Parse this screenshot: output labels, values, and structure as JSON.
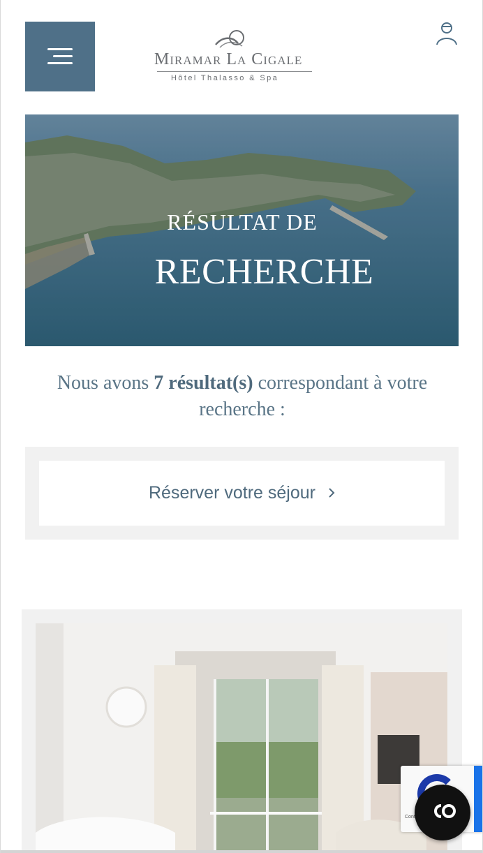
{
  "header": {
    "menu_icon": "hamburger-icon",
    "logo": {
      "name": "Miramar La Cigale",
      "subtitle": "Hôtel Thalasso & Spa"
    },
    "user_icon": "user-icon"
  },
  "hero": {
    "title_line1": "RÉSULTAT DE",
    "title_line2": "RECHERCHE"
  },
  "results": {
    "prefix": "Nous avons ",
    "count_text": "7 résultat(s)",
    "suffix": " correspondant à votre recherche :"
  },
  "reserve": {
    "label": "Réserver votre séjour",
    "icon": "chevron-right-icon"
  },
  "recaptcha": {
    "text": "Cont"
  },
  "chat": {
    "icon": "chat-icon"
  },
  "colors": {
    "accent": "#4f7088",
    "text_blue": "#5a7587",
    "panel_bg": "#f1f1f1"
  }
}
